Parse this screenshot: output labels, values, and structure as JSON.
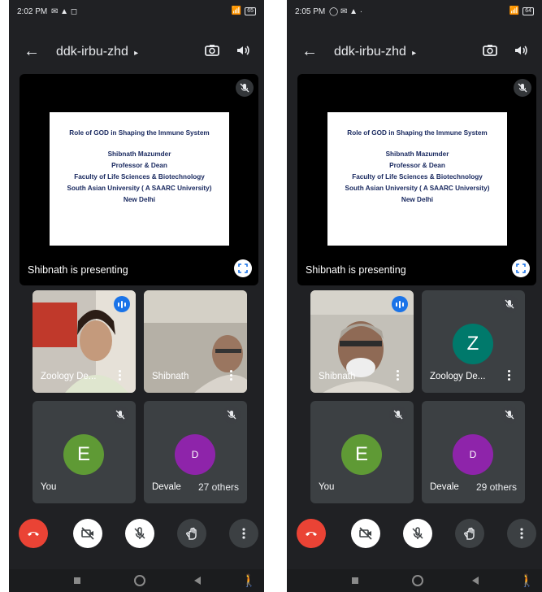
{
  "left": {
    "status_time": "2:02 PM",
    "status_icons": "✉ ▲ ◻",
    "battery": "65",
    "meeting_code": "ddk-irbu-zhd",
    "slide": {
      "title": "Role of GOD in Shaping the Immune System",
      "lines": [
        "Shibnath Mazumder",
        "Professor & Dean",
        "Faculty of Life Sciences & Biotechnology",
        "South Asian University ( A SAARC University)",
        "New Delhi"
      ]
    },
    "presenting_text": "Shibnath is presenting",
    "tiles": [
      {
        "name": "Zoology De...",
        "type": "video",
        "speaking": true
      },
      {
        "name": "Shibnath",
        "type": "video",
        "speaking": false
      },
      {
        "name": "You",
        "type": "avatar",
        "initial": "E",
        "avatar_color": "#5f9a35",
        "muted": true
      },
      {
        "name": "Devale",
        "type": "avatar",
        "initial": "D",
        "avatar_color": "#8e24aa",
        "muted": true,
        "others": "27 others"
      }
    ]
  },
  "right": {
    "status_time": "2:05 PM",
    "status_icons": "◯ ✉ ▲ ·",
    "battery": "64",
    "meeting_code": "ddk-irbu-zhd",
    "slide": {
      "title": "Role of GOD in Shaping the Immune System",
      "lines": [
        "Shibnath Mazumder",
        "Professor & Dean",
        "Faculty of Life Sciences & Biotechnology",
        "South Asian University ( A SAARC University)",
        "New Delhi"
      ]
    },
    "presenting_text": "Shibnath is presenting",
    "tiles": [
      {
        "name": "Shibnath",
        "type": "video",
        "speaking": true
      },
      {
        "name": "Zoology De...",
        "type": "avatar",
        "initial": "Z",
        "avatar_color": "#00796b",
        "muted": true
      },
      {
        "name": "You",
        "type": "avatar",
        "initial": "E",
        "avatar_color": "#5f9a35",
        "muted": true
      },
      {
        "name": "Devale",
        "type": "avatar",
        "initial": "D",
        "avatar_color": "#8e24aa",
        "muted": true,
        "others": "29 others"
      }
    ]
  },
  "icons": [
    "arrow-back-icon",
    "chevron-right-icon",
    "switch-camera-icon",
    "speaker-icon",
    "mic-off-icon",
    "fullscreen-icon",
    "end-call-icon",
    "camera-off-icon",
    "raise-hand-icon",
    "more-options-icon",
    "nav-recents-icon",
    "nav-home-icon",
    "nav-back-icon",
    "accessibility-icon"
  ],
  "colors": {
    "background": "#202124",
    "tile": "#3c4043",
    "end_call": "#ea4335",
    "speaking": "#1a73e8"
  }
}
